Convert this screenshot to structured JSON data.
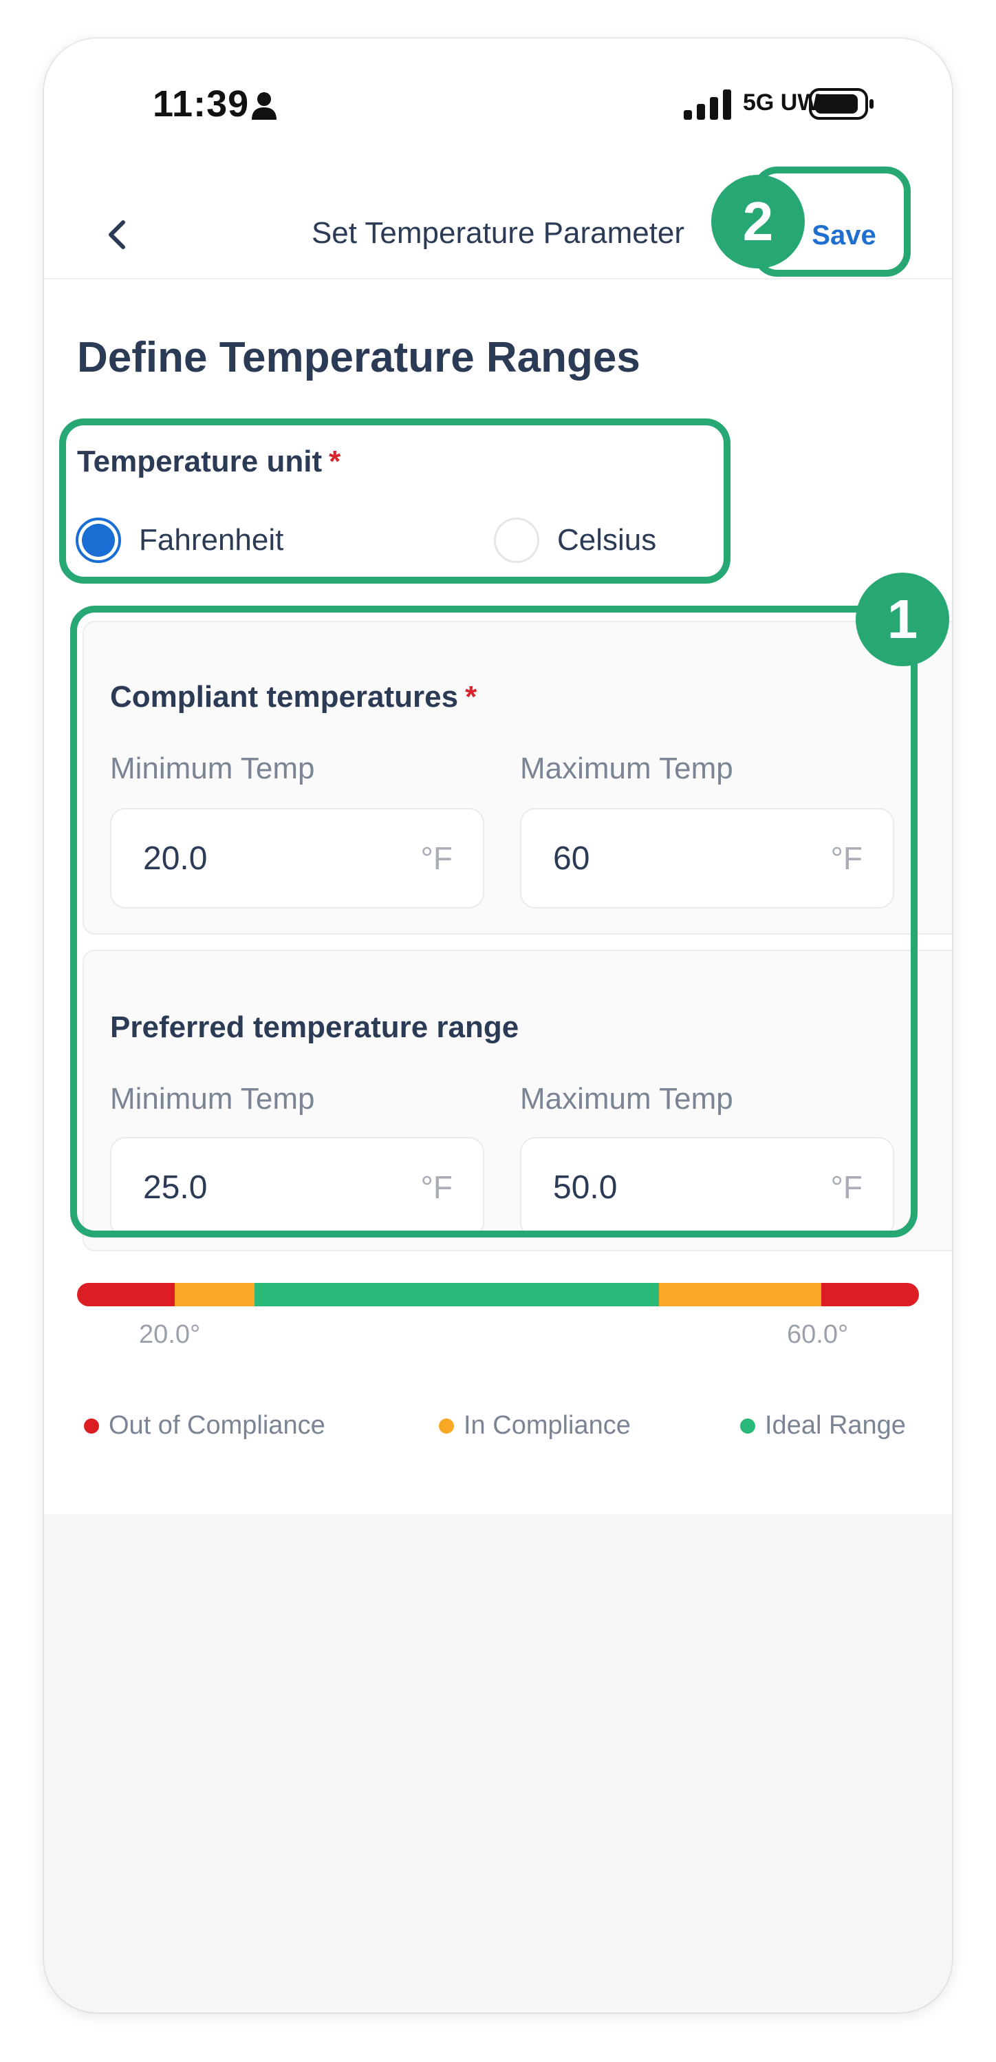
{
  "status_bar": {
    "time": "11:39",
    "network": "5G UW"
  },
  "header": {
    "title": "Set Temperature Parameter",
    "save_label": "Save"
  },
  "page_title": "Define Temperature Ranges",
  "unit": {
    "label": "Temperature unit",
    "required_mark": "*",
    "options": [
      {
        "label": "Fahrenheit",
        "selected": true
      },
      {
        "label": "Celsius",
        "selected": false
      }
    ]
  },
  "compliant": {
    "title": "Compliant temperatures",
    "required_mark": "*",
    "min_label": "Minimum Temp",
    "max_label": "Maximum Temp",
    "min_value": "20.0",
    "max_value": "60",
    "unit_suffix": "°F"
  },
  "preferred": {
    "title": "Preferred temperature range",
    "min_label": "Minimum Temp",
    "max_label": "Maximum Temp",
    "min_value": "25.0",
    "max_value": "50.0",
    "unit_suffix": "°F"
  },
  "range_bar": {
    "min_label": "20.0°",
    "max_label": "60.0°",
    "colors": {
      "out": "#dc1e24",
      "in": "#f8a824",
      "ideal": "#2bb97a"
    }
  },
  "legend": [
    {
      "label": "Out of Compliance",
      "color": "#dc1e24"
    },
    {
      "label": "In Compliance",
      "color": "#f8a824"
    },
    {
      "label": "Ideal Range",
      "color": "#2bb97a"
    }
  ],
  "annotations": {
    "badge_1": "1",
    "badge_2": "2",
    "accent": "#27a774"
  }
}
